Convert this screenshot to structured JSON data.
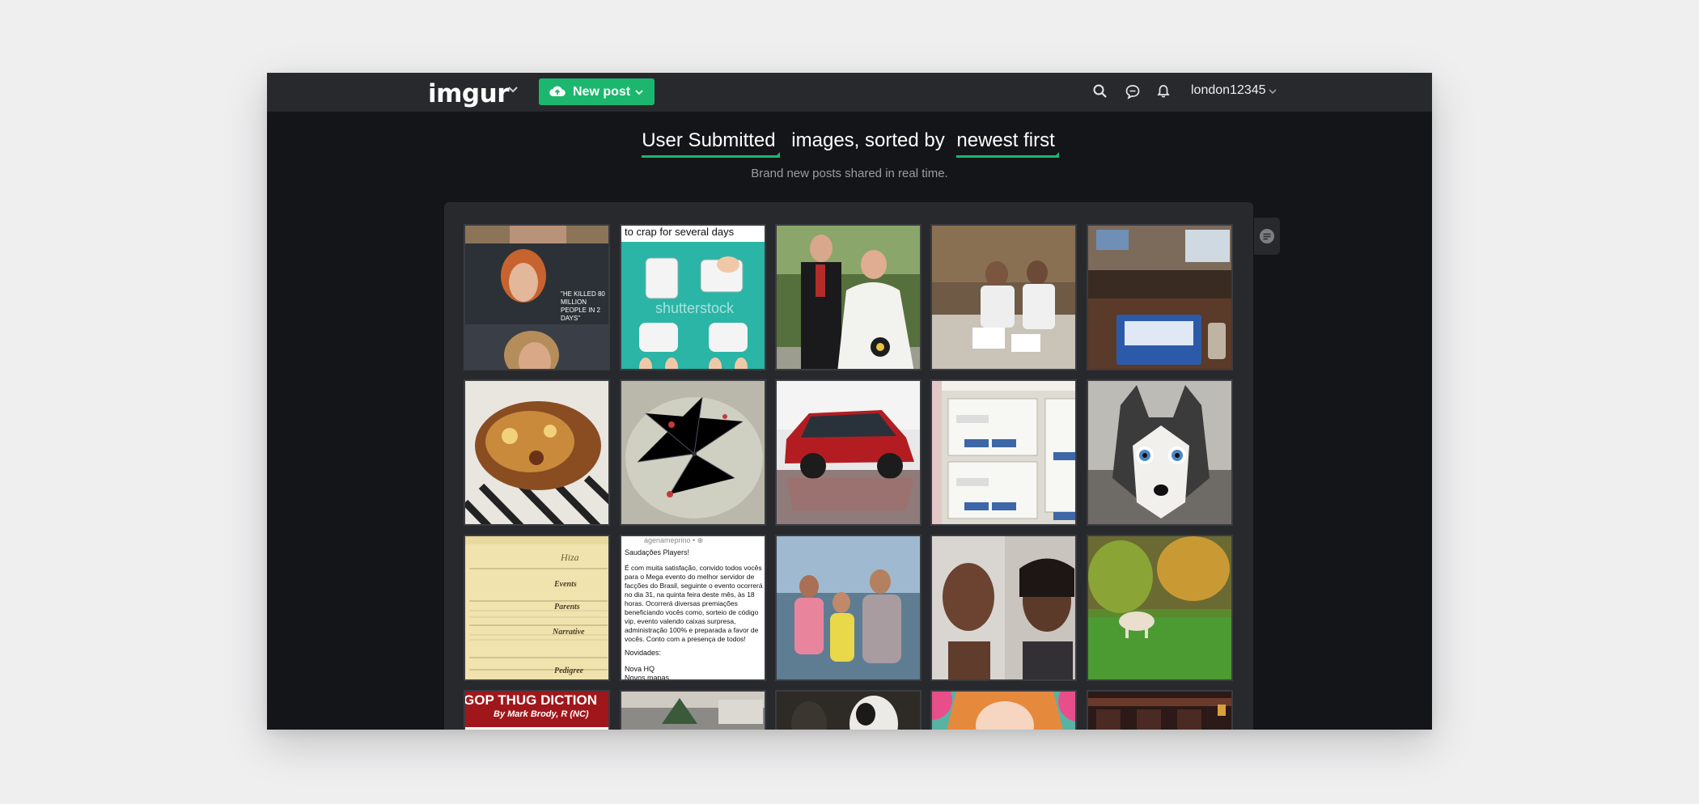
{
  "header": {
    "logo": "imgur",
    "new_post_label": "New post",
    "username": "london12345",
    "icons": [
      "search-icon",
      "messages-icon",
      "notifications-icon"
    ]
  },
  "hero": {
    "section_filter": "User Submitted",
    "middle_text": "images, sorted by",
    "sort_filter": "newest first",
    "subtitle": "Brand new posts shared in real time."
  },
  "thumbnails": {
    "avengers_caption": "\"HE KILLED 80 MILLION PEOPLE IN 2 DAYS\"",
    "diaper_caption": "to crap for several days",
    "diaper_watermark": "shutterstock",
    "genealogy": {
      "title": "Hiza",
      "events": "Events",
      "parents": "Parents",
      "narrative": "Narrative",
      "pedigree": "Pedigree"
    },
    "portuguese_post": {
      "header": "agenameprino • ⊕",
      "greeting": "Saudações Players!",
      "body": "É com muita satisfação, convido todos vocês para o Mega evento do melhor servidor de facções do Brasil, seguinte o evento ocorrerá no dia 31, na quinta feira deste mês, às 18 horas. Ocorrerá diversas premiações beneficiando vocês como, sorteio de código vip, evento valendo caixas surpresa, administração 100% e preparada a favor de vocês. Conto com a presença de todos!",
      "news_label": "Novidades:",
      "news_1": "Nova HQ",
      "news_2": "Novos mapas"
    },
    "dictionary_title": "GOP THUG DICTION",
    "dictionary_author": "By Mark Brody, R (NC)"
  },
  "colors": {
    "accent": "#1bb76e",
    "page_background": "#141518",
    "topbar": "#27292d"
  }
}
